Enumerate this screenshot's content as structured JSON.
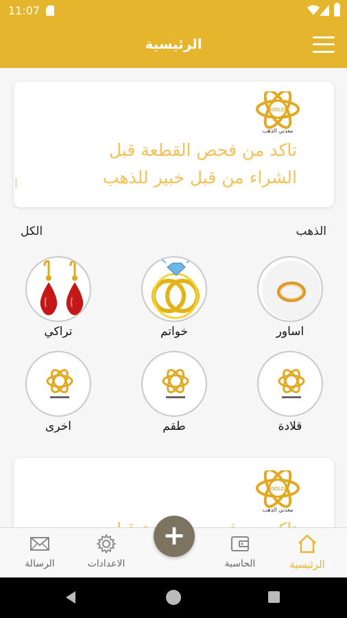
{
  "status_bar": {
    "time": "11:07"
  },
  "app_bar": {
    "title": "الرئيسية"
  },
  "banner": {
    "logo_text_en": "GOLD",
    "logo_text_ar": "معدني الذهب",
    "text_line1": "تاكد من فحص القطعة قبل",
    "text_line2": "الشراء من قبل خبير للذهب"
  },
  "section": {
    "title": "الذهب",
    "view_all": "الكل"
  },
  "categories": [
    {
      "label": "اساور",
      "icon": "bracelet-icon"
    },
    {
      "label": "خواتم",
      "icon": "ring-icon"
    },
    {
      "label": "تراكي",
      "icon": "earrings-icon"
    },
    {
      "label": "قلادة",
      "icon": "gold-logo-icon"
    },
    {
      "label": "طقم",
      "icon": "gold-logo-icon"
    },
    {
      "label": "اخرى",
      "icon": "gold-logo-icon"
    }
  ],
  "bottom_nav": {
    "home": "الرئيسية",
    "calculator": "الحاسبة",
    "settings": "الاعدادات",
    "message": "الرسالة",
    "add": "+"
  },
  "colors": {
    "accent": "#e5b52e",
    "fab": "#7c7460",
    "banner_text": "#f2c25a"
  }
}
